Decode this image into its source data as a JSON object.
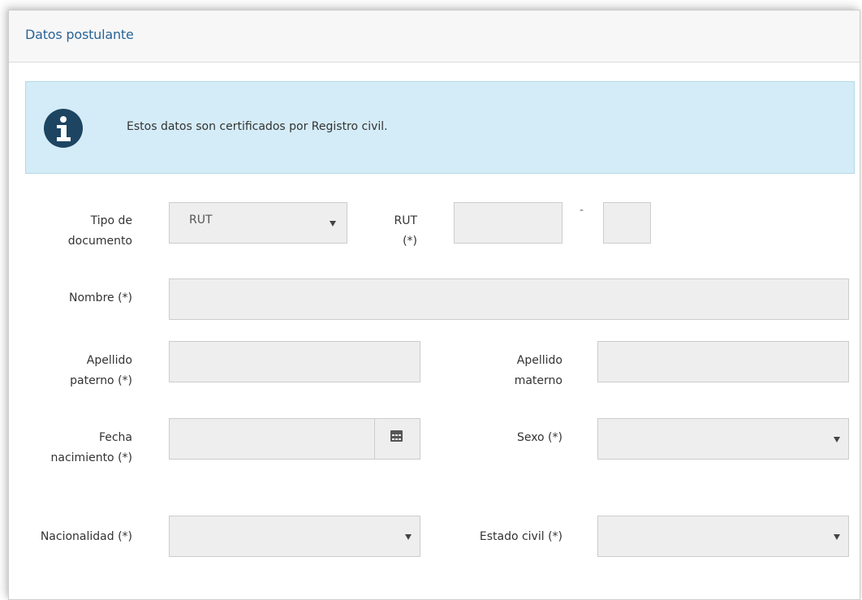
{
  "panel": {
    "title": "Datos postulante"
  },
  "alert": {
    "icon": "info-icon",
    "text": "Estos datos son certificados por Registro civil."
  },
  "form": {
    "tipo_documento": {
      "label_line1": "Tipo de",
      "label_line2": "documento",
      "value": "RUT"
    },
    "rut": {
      "label_line1": "RUT",
      "label_line2": "(*)",
      "number_value": "",
      "separator": "-",
      "dv_value": ""
    },
    "nombre": {
      "label": "Nombre (*)",
      "value": ""
    },
    "apellido_paterno": {
      "label_line1": "Apellido",
      "label_line2": "paterno (*)",
      "value": ""
    },
    "apellido_materno": {
      "label_line1": "Apellido",
      "label_line2": "materno",
      "value": ""
    },
    "fecha_nacimiento": {
      "label_line1": "Fecha",
      "label_line2": "nacimiento (*)",
      "value": "",
      "icon": "calendar-icon"
    },
    "sexo": {
      "label": "Sexo (*)",
      "value": ""
    },
    "nacionalidad": {
      "label": "Nacionalidad (*)",
      "value": ""
    },
    "estado_civil": {
      "label": "Estado civil (*)",
      "value": ""
    }
  },
  "colors": {
    "title_blue": "#2a6496",
    "alert_bg": "#d4ecf7",
    "icon_dark": "#1d4562",
    "field_bg": "#eeeeee"
  }
}
